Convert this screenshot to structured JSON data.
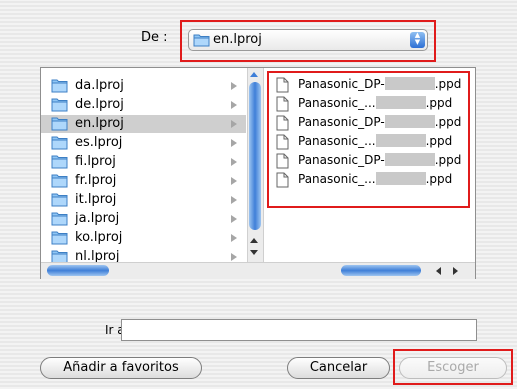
{
  "location": {
    "label": "De :",
    "selected": "en.lproj"
  },
  "folders": [
    {
      "label": "da.lproj"
    },
    {
      "label": "de.lproj"
    },
    {
      "label": "en.lproj",
      "selected": true
    },
    {
      "label": "es.lproj"
    },
    {
      "label": "fi.lproj"
    },
    {
      "label": "fr.lproj"
    },
    {
      "label": "it.lproj"
    },
    {
      "label": "ja.lproj"
    },
    {
      "label": "ko.lproj"
    },
    {
      "label": "nl.lproj"
    }
  ],
  "files": [
    {
      "prefix": "Panasonic_DP-",
      "ext": ".ppd"
    },
    {
      "prefix": "Panasonic_...",
      "ext": ".ppd"
    },
    {
      "prefix": "Panasonic_DP-",
      "ext": ".ppd"
    },
    {
      "prefix": "Panasonic_...",
      "ext": ".ppd"
    },
    {
      "prefix": "Panasonic_DP-",
      "ext": ".ppd"
    },
    {
      "prefix": "Panasonic_...",
      "ext": ".ppd"
    }
  ],
  "goto": {
    "label": "Ir a:",
    "value": ""
  },
  "buttons": {
    "add_favorites": "Añadir a favoritos",
    "cancel": "Cancelar",
    "choose": "Escoger"
  },
  "colors": {
    "highlight": "#e01b1b",
    "accent": "#3f7fd8",
    "selection": "#cfcfcf"
  }
}
